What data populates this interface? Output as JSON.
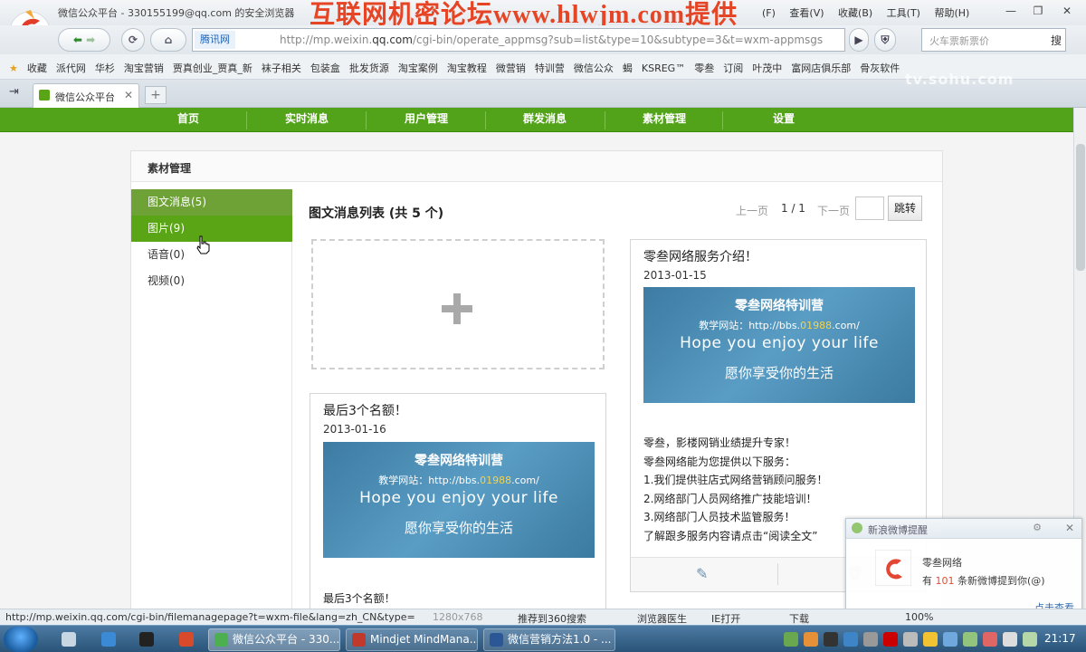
{
  "browser": {
    "title": "微信公众平台 - 330155199@qq.com 的安全浏览器",
    "watermark": "互联网机密论坛www.hlwjm.com提供",
    "menus": [
      "(F)",
      "查看(V)",
      "收藏(B)",
      "工具(T)",
      "帮助(H)"
    ],
    "address_badge": "腾讯网",
    "url_prefix": "http://mp.weixin.",
    "url_domain": "qq.com",
    "url_rest": "/cgi-bin/operate_appmsg?sub=list&type=10&subtype=3&t=wxm-appmsgs-list",
    "search_placeholder": "火车票新票价",
    "search_button": "搜",
    "favorites": [
      "收藏",
      "派代网",
      "华杉",
      "淘宝营销",
      "贾真创业_贾真_新",
      "袜子相关",
      "包装盒",
      "批发货源",
      "淘宝案例",
      "淘宝教程",
      "微营销",
      "特训营",
      "微信公众",
      "蝎",
      "KSREG™",
      "零叁",
      "订阅",
      "叶茂中",
      "富网店俱乐部",
      "骨灰软件"
    ],
    "tab_label": "微信公众平台",
    "sohu": "tv.sohu.com",
    "status_url": "http://mp.weixin.qq.com/cgi-bin/filemanagepage?t=wxm-file&lang=zh_CN&type=",
    "status_res": "1280x768",
    "status_items": [
      "推荐到360搜索",
      "浏览器医生",
      "IE打开",
      "下载",
      "100%"
    ]
  },
  "nav": {
    "items": [
      "首页",
      "实时消息",
      "用户管理",
      "群发消息",
      "素材管理",
      "设置"
    ]
  },
  "panel": {
    "title": "素材管理",
    "sidebar": [
      "图文消息(5)",
      "图片(9)",
      "语音(0)",
      "视频(0)"
    ],
    "list_title": "图文消息列表 (共 5 个)",
    "pager": {
      "prev": "上一页",
      "page": "1 / 1",
      "next": "下一页",
      "go": "跳转"
    }
  },
  "cards": {
    "image_text": {
      "line1": "零叁网络特训营",
      "line2_prefix": "教学网站：http://bbs.",
      "line2_hl": "01988",
      "line2_suffix": ".com/",
      "line3": "Hope you enjoy your life",
      "line4": "愿你享受你的生活"
    },
    "card1": {
      "title": "零叁网络服务介绍！",
      "date": "2013-01-15",
      "desc": [
        "零叁，影楼网销业绩提升专家！",
        "零叁网络能为您提供以下服务：",
        "1.我们提供驻店式网络营销顾问服务！",
        "2.网络部门人员网络推广技能培训！",
        "3.网络部门人员技术监管服务！",
        "了解跟多服务内容请点击“阅读全文”"
      ]
    },
    "card2": {
      "title": "最后3个名额！",
      "date": "2013-01-16",
      "desc": "最后3个名额！"
    }
  },
  "popup": {
    "title": "新浪微博提醒",
    "name": "零叁网络",
    "msg_prefix": "有 ",
    "msg_count": "101",
    "msg_suffix": " 条新微博提到你(@)",
    "link": "点击查看"
  },
  "taskbar": {
    "items": [
      "微信公众平台 - 330...",
      "Mindjet MindMana...",
      "微信营销方法1.0 - ..."
    ],
    "clock": "21:17"
  },
  "colors": {
    "nav_green": "#53a31a",
    "active_item": "#6ea237",
    "hover_item": "#5aa516",
    "watermark": "#e64525"
  }
}
